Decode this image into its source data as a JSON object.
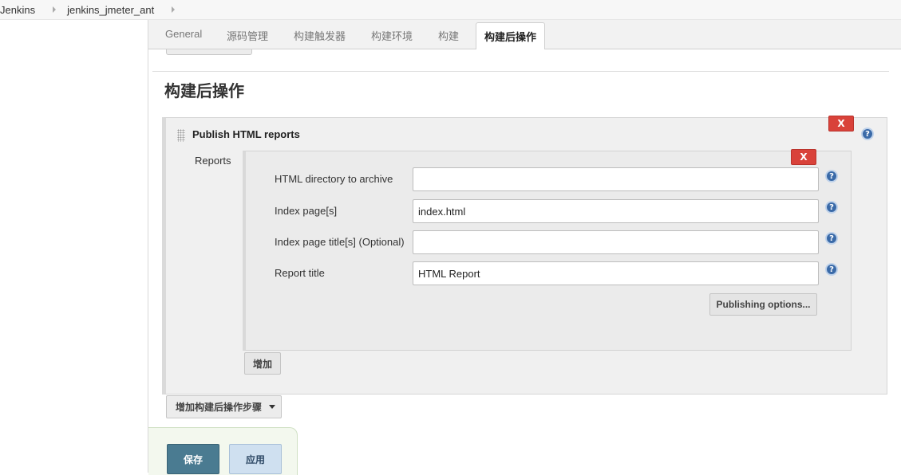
{
  "breadcrumb": {
    "items": [
      "Jenkins",
      "jenkins_jmeter_ant"
    ]
  },
  "tabs": [
    {
      "label": "General",
      "active": false
    },
    {
      "label": "源码管理",
      "active": false
    },
    {
      "label": "构建触发器",
      "active": false
    },
    {
      "label": "构建环境",
      "active": false
    },
    {
      "label": "构建",
      "active": false
    },
    {
      "label": "构建后操作",
      "active": true
    }
  ],
  "section": {
    "title": "构建后操作"
  },
  "publisher": {
    "title": "Publish HTML reports",
    "delete_label": "X",
    "reports_label": "Reports",
    "report": {
      "delete_label": "X",
      "fields": [
        {
          "label": "HTML directory to archive",
          "value": ""
        },
        {
          "label": "Index page[s]",
          "value": "index.html"
        },
        {
          "label": "Index page title[s] (Optional)",
          "value": ""
        },
        {
          "label": "Report title",
          "value": "HTML Report"
        }
      ],
      "publishing_options_label": "Publishing options..."
    },
    "add_label": "增加"
  },
  "add_post_build_step_label": "增加构建后操作步骤",
  "actions": {
    "save_label": "保存",
    "apply_label": "应用"
  },
  "icons": {
    "help": "question-circle-icon",
    "delete": "close-x",
    "drag": "drag-handle-icon",
    "dropdown": "caret-down-icon",
    "breadcrumb_separator": "chevron-right-icon"
  },
  "colors": {
    "delete_red": "#d9423a",
    "help_blue": "#3a6aa8",
    "save_button": "#4a7b91",
    "apply_button": "#cfe0f0"
  }
}
